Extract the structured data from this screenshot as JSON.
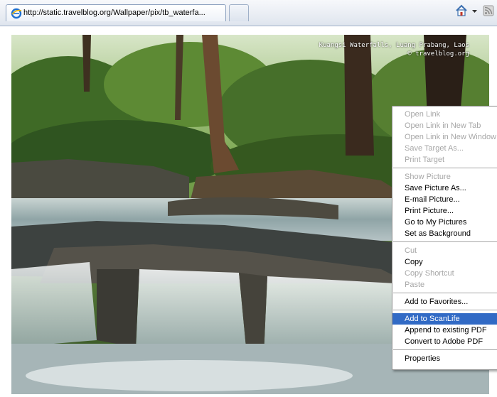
{
  "browser": {
    "tab_title": "http://static.travelblog.org/Wallpaper/pix/tb_waterfa...",
    "toolbar_icons": [
      "home-icon",
      "dropdown-arrow-icon",
      "rss-feed-icon"
    ]
  },
  "photo": {
    "watermark_line1": "Kuangsi Waterfalls, Luang Prabang, Laos",
    "watermark_line2": "© travelblog.org"
  },
  "context_menu": {
    "groups": [
      [
        {
          "label": "Open Link",
          "enabled": false
        },
        {
          "label": "Open Link in New Tab",
          "enabled": false
        },
        {
          "label": "Open Link in New Window",
          "enabled": false
        },
        {
          "label": "Save Target As...",
          "enabled": false
        },
        {
          "label": "Print Target",
          "enabled": false
        }
      ],
      [
        {
          "label": "Show Picture",
          "enabled": false
        },
        {
          "label": "Save Picture As...",
          "enabled": true
        },
        {
          "label": "E-mail Picture...",
          "enabled": true
        },
        {
          "label": "Print Picture...",
          "enabled": true
        },
        {
          "label": "Go to My Pictures",
          "enabled": true
        },
        {
          "label": "Set as Background",
          "enabled": true
        }
      ],
      [
        {
          "label": "Cut",
          "enabled": false
        },
        {
          "label": "Copy",
          "enabled": true
        },
        {
          "label": "Copy Shortcut",
          "enabled": false
        },
        {
          "label": "Paste",
          "enabled": false
        }
      ],
      [
        {
          "label": "Add to Favorites...",
          "enabled": true
        }
      ],
      [
        {
          "label": "Add to ScanLife",
          "enabled": true,
          "highlighted": true
        },
        {
          "label": "Append to existing PDF",
          "enabled": true
        },
        {
          "label": "Convert to Adobe PDF",
          "enabled": true
        }
      ],
      [
        {
          "label": "Properties",
          "enabled": true
        }
      ]
    ]
  },
  "colors": {
    "highlight": "#316ac5",
    "disabled_text": "#a7a7a7"
  }
}
